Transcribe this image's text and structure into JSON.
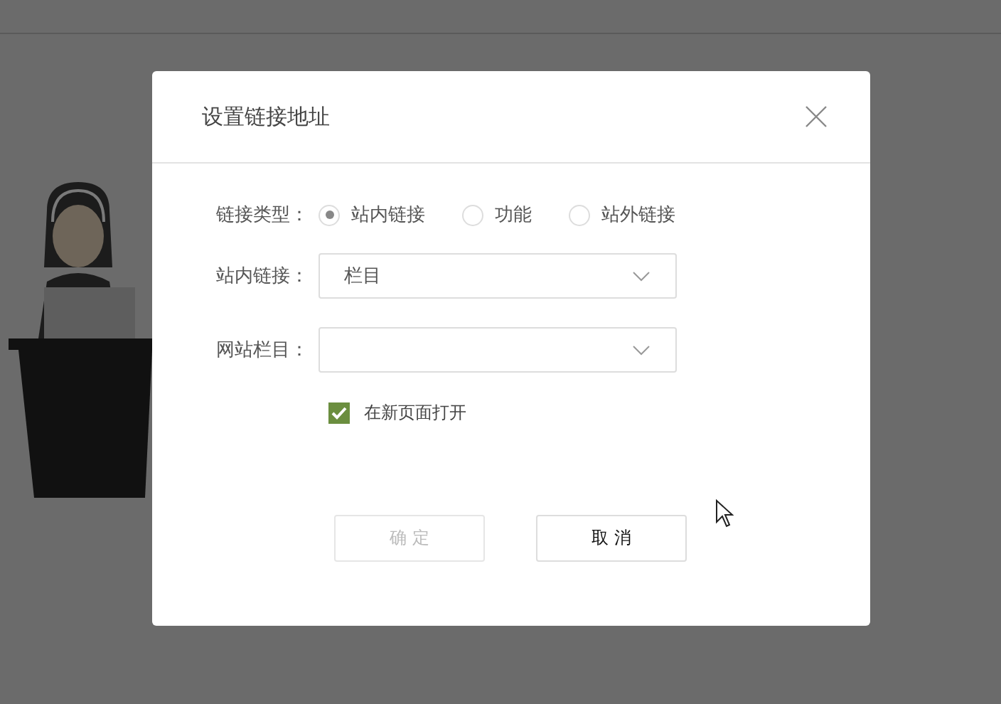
{
  "dialog": {
    "title": "设置链接地址",
    "fields": [
      {
        "kind": "radio",
        "label": "链接类型：",
        "options": [
          {
            "label": "站内链接",
            "selected": true
          },
          {
            "label": "功能",
            "selected": false
          },
          {
            "label": "站外链接",
            "selected": false
          }
        ]
      },
      {
        "kind": "select",
        "label": "站内链接：",
        "value": "栏目"
      },
      {
        "kind": "select",
        "label": "网站栏目："
      },
      {
        "kind": "checkbox",
        "label": "在新页面打开",
        "checked": true
      }
    ],
    "buttons": [
      {
        "label": "确 定",
        "disabled": true
      },
      {
        "label": "取 消",
        "disabled": false
      }
    ]
  }
}
